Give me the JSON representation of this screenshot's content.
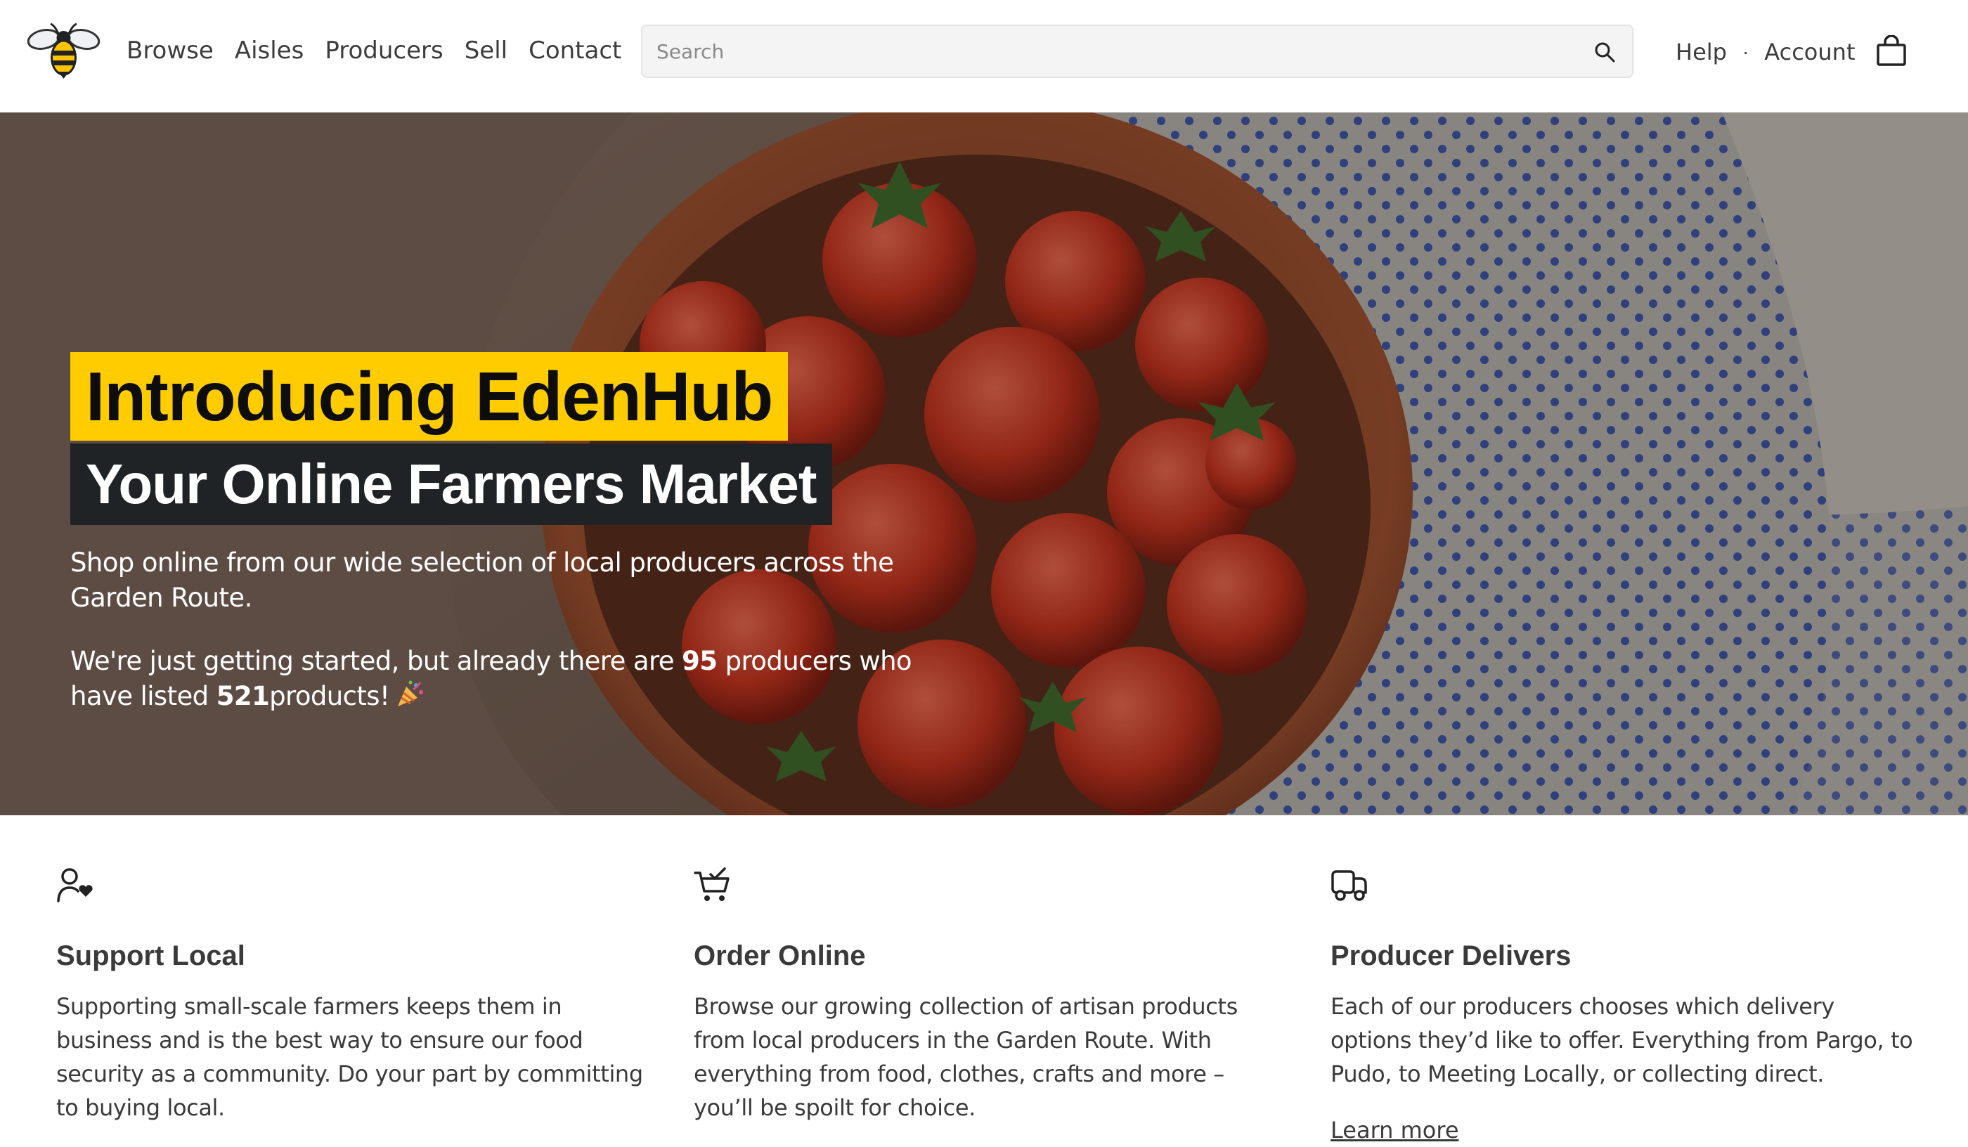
{
  "header": {
    "nav": [
      "Browse",
      "Aisles",
      "Producers",
      "Sell",
      "Contact"
    ],
    "search_placeholder": "Search",
    "help_label": "Help",
    "separator": "·",
    "account_label": "Account",
    "icons": {
      "logo": "bee-logo",
      "search": "search-icon",
      "cart": "shopping-bag-icon"
    }
  },
  "hero": {
    "title_line1": "Introducing EdenHub",
    "title_line2": "Your Online Farmers Market",
    "paragraph1": "Shop online from our wide selection of local producers across the Garden Route.",
    "paragraph2_part1": "We're just getting started, but already there are",
    "producer_count": "95",
    "paragraph2_part2": "producers who have listed",
    "product_count": "521",
    "paragraph2_part3": "products!",
    "emoji_icon": "party-popper-icon",
    "accent_color": "#ffcc00",
    "title2_bg": "#1f2326"
  },
  "features": [
    {
      "icon": "user-heart-icon",
      "title": "Support Local",
      "text": "Supporting small-scale farmers keeps them in business and is the best way to ensure our food security as a community. Do your part by committing to buying local."
    },
    {
      "icon": "cart-check-icon",
      "title": "Order Online",
      "text": "Browse our growing collection of artisan products from local producers in the Garden Route. With everything from food, clothes, crafts and more – you’ll be spoilt for choice."
    },
    {
      "icon": "delivery-truck-icon",
      "title": "Producer Delivers",
      "text": "Each of our producers chooses which delivery options they’d like to offer. Everything from Pargo, to Pudo, to Meeting Locally, or collecting direct.",
      "link_label": "Learn more"
    }
  ]
}
